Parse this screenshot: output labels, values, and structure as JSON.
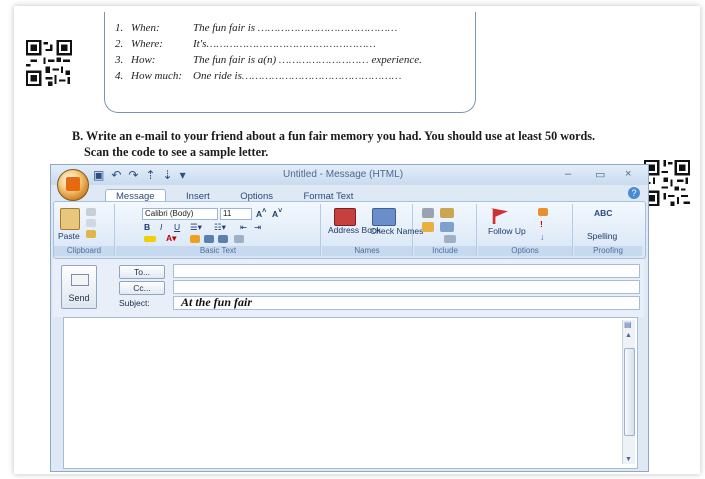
{
  "worksheet": {
    "qa_items": [
      {
        "num": "1.",
        "question": "When:",
        "answer_prefix": "The fun fair is"
      },
      {
        "num": "2.",
        "question": "Where:",
        "answer_prefix": "It's"
      },
      {
        "num": "3.",
        "question": "How:",
        "answer_prefix": "The fun fair is a(n)",
        "answer_suffix": "experience."
      },
      {
        "num": "4.",
        "question": "How much:",
        "answer_prefix": "One ride is"
      }
    ],
    "instruction_line1": "B. Write an e-mail to your friend about a fun fair memory you had. You should use at least  50 words.",
    "instruction_line2": "Scan the code to see a sample letter."
  },
  "window": {
    "title": "Untitled - Message (HTML)",
    "controls": {
      "minimize": "–",
      "maximize": "▭",
      "close": "×"
    },
    "tabs": [
      "Message",
      "Insert",
      "Options",
      "Format Text"
    ],
    "active_tab": "Message"
  },
  "ribbon": {
    "groups": [
      {
        "label": "Clipboard",
        "items": [
          "Paste"
        ]
      },
      {
        "label": "Basic Text",
        "font": "Calibri (Body)",
        "size": "11"
      },
      {
        "label": "Names",
        "items": [
          "Address Book",
          "Check Names"
        ]
      },
      {
        "label": "Include"
      },
      {
        "label": "Options",
        "items": [
          "Follow Up"
        ]
      },
      {
        "label": "Proofing",
        "items": [
          "Spelling"
        ]
      }
    ]
  },
  "compose": {
    "send_label": "Send",
    "to_label": "To...",
    "cc_label": "Cc...",
    "subject_label": "Subject:",
    "to_value": "",
    "cc_value": "",
    "subject_value": "At the fun fair",
    "body_value": ""
  }
}
